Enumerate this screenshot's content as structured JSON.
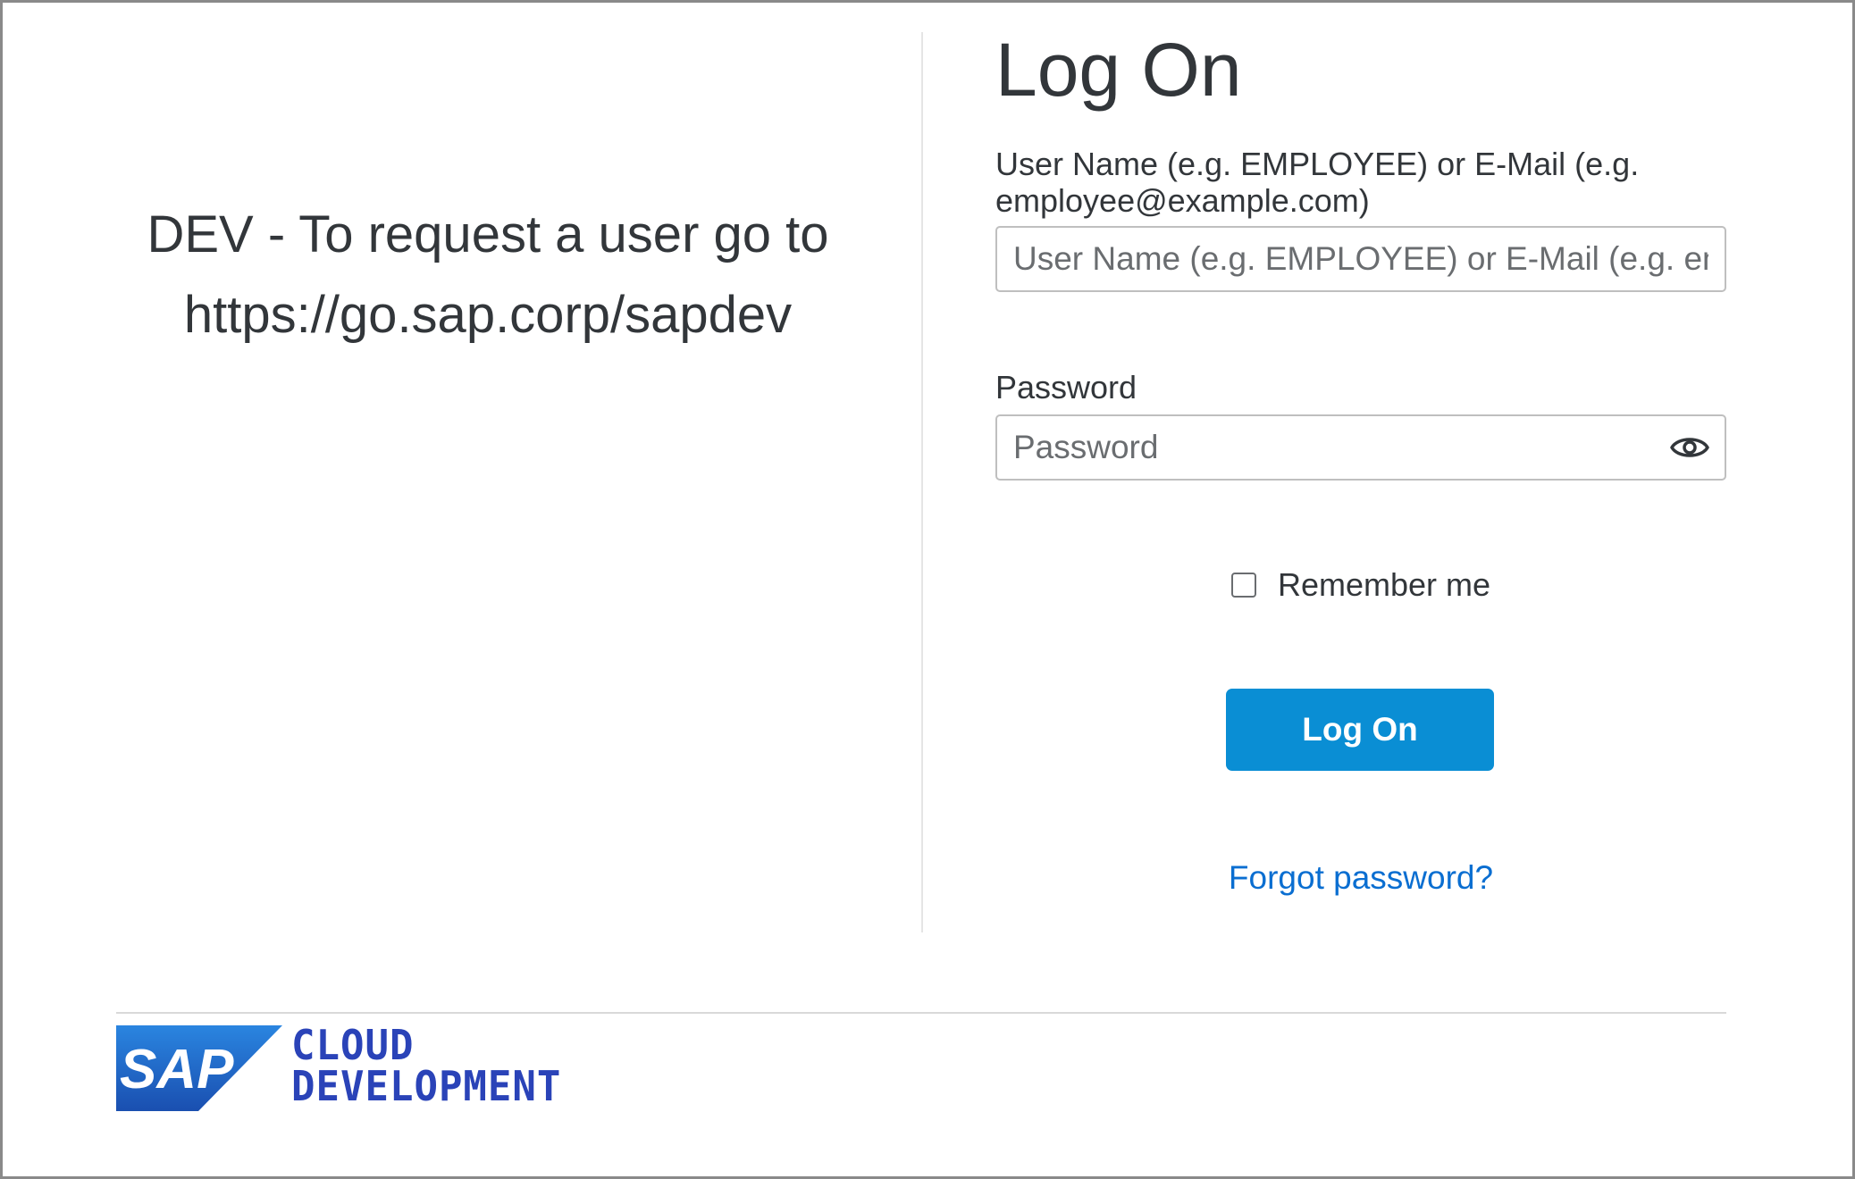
{
  "info": {
    "line1": "DEV - To request a user go to",
    "line2": "https://go.sap.corp/sapdev"
  },
  "form": {
    "title": "Log On",
    "username_label": "User Name (e.g. EMPLOYEE) or E-Mail (e.g. employee@example.com)",
    "username_placeholder": "User Name (e.g. EMPLOYEE) or E-Mail (e.g. employee@example.com)",
    "password_label": "Password",
    "password_placeholder": "Password",
    "show_password_icon": "eye-icon",
    "remember_label": "Remember me",
    "remember_checked": false,
    "submit_label": "Log On",
    "forgot_label": "Forgot password?"
  },
  "footer": {
    "logo_text": "SAP",
    "product_line1": "CLOUD",
    "product_line2": "DEVELOPMENT"
  },
  "colors": {
    "primary_button": "#0a8ed4",
    "link": "#0a6ed1",
    "logo_blue": "#1f62c4",
    "product_text": "#2a43b8"
  }
}
